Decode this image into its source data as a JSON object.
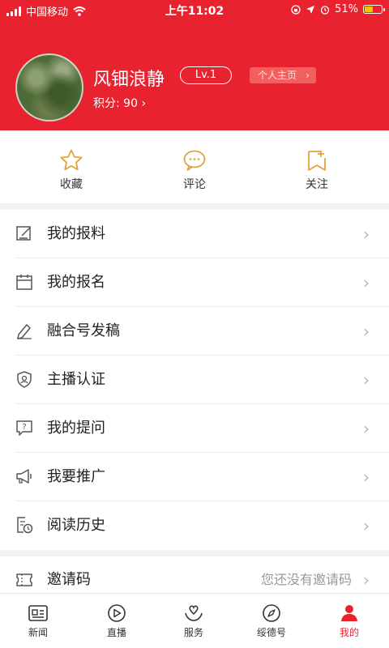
{
  "status_bar": {
    "carrier": "中国移动",
    "time": "上午11:02",
    "battery": "51%",
    "battery_level": 0.51
  },
  "profile": {
    "username": "风钿浪静",
    "level": "Lv.1",
    "homepage_label": "个人主页",
    "points": "积分: 90"
  },
  "quick_actions": [
    {
      "label": "收藏",
      "icon": "star-icon"
    },
    {
      "label": "评论",
      "icon": "comment-icon"
    },
    {
      "label": "关注",
      "icon": "follow-icon"
    }
  ],
  "menu": [
    {
      "label": "我的报料",
      "icon": "edit-note-icon"
    },
    {
      "label": "我的报名",
      "icon": "calendar-icon"
    },
    {
      "label": "融合号发稿",
      "icon": "pen-icon"
    },
    {
      "label": "主播认证",
      "icon": "shield-user-icon"
    },
    {
      "label": "我的提问",
      "icon": "question-icon"
    },
    {
      "label": "我要推广",
      "icon": "megaphone-icon"
    },
    {
      "label": "阅读历史",
      "icon": "history-icon"
    }
  ],
  "invite": {
    "label": "邀请码",
    "hint": "您还没有邀请码",
    "icon": "ticket-icon"
  },
  "tabbar": [
    {
      "label": "新闻",
      "icon": "news-icon"
    },
    {
      "label": "直播",
      "icon": "live-icon"
    },
    {
      "label": "服务",
      "icon": "service-icon"
    },
    {
      "label": "绥德号",
      "icon": "compass-icon"
    },
    {
      "label": "我的",
      "icon": "profile-icon",
      "active": true
    }
  ],
  "colors": {
    "brand": "#e8232f",
    "quick_icon": "#e3a33a",
    "muted": "#999999"
  }
}
